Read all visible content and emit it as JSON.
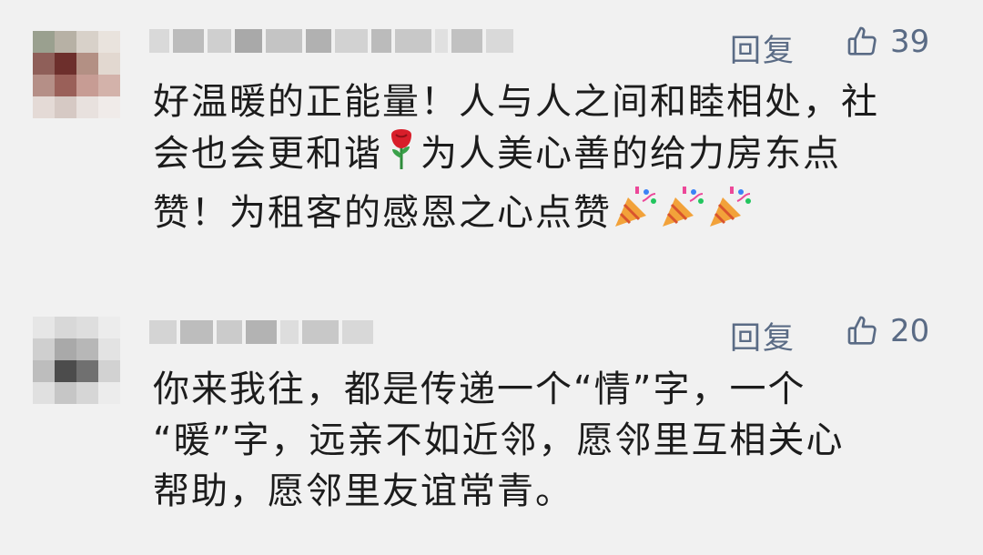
{
  "comments": [
    {
      "reply_label": "回复",
      "like_count": "39",
      "text_lines": [
        "好温暖的正能量！人与人之间和睦相处，社",
        "会也会更和谐",
        "为人美心善的给力房东点",
        "赞！为租客的感恩之心点赞"
      ],
      "emojis": [
        "rose-emoji",
        "party-popper-emoji"
      ]
    },
    {
      "reply_label": "回复",
      "like_count": "20",
      "text_lines": [
        "你来我往，都是传递一个“情”字，一个",
        "“暖”字，远亲不如近邻，愿邻里互相关心",
        "帮助，愿邻里友谊常青。"
      ]
    }
  ],
  "colors": {
    "background": "#f1f1f1",
    "meta_text": "#5a6b85",
    "body_text": "#1c1c1c"
  }
}
